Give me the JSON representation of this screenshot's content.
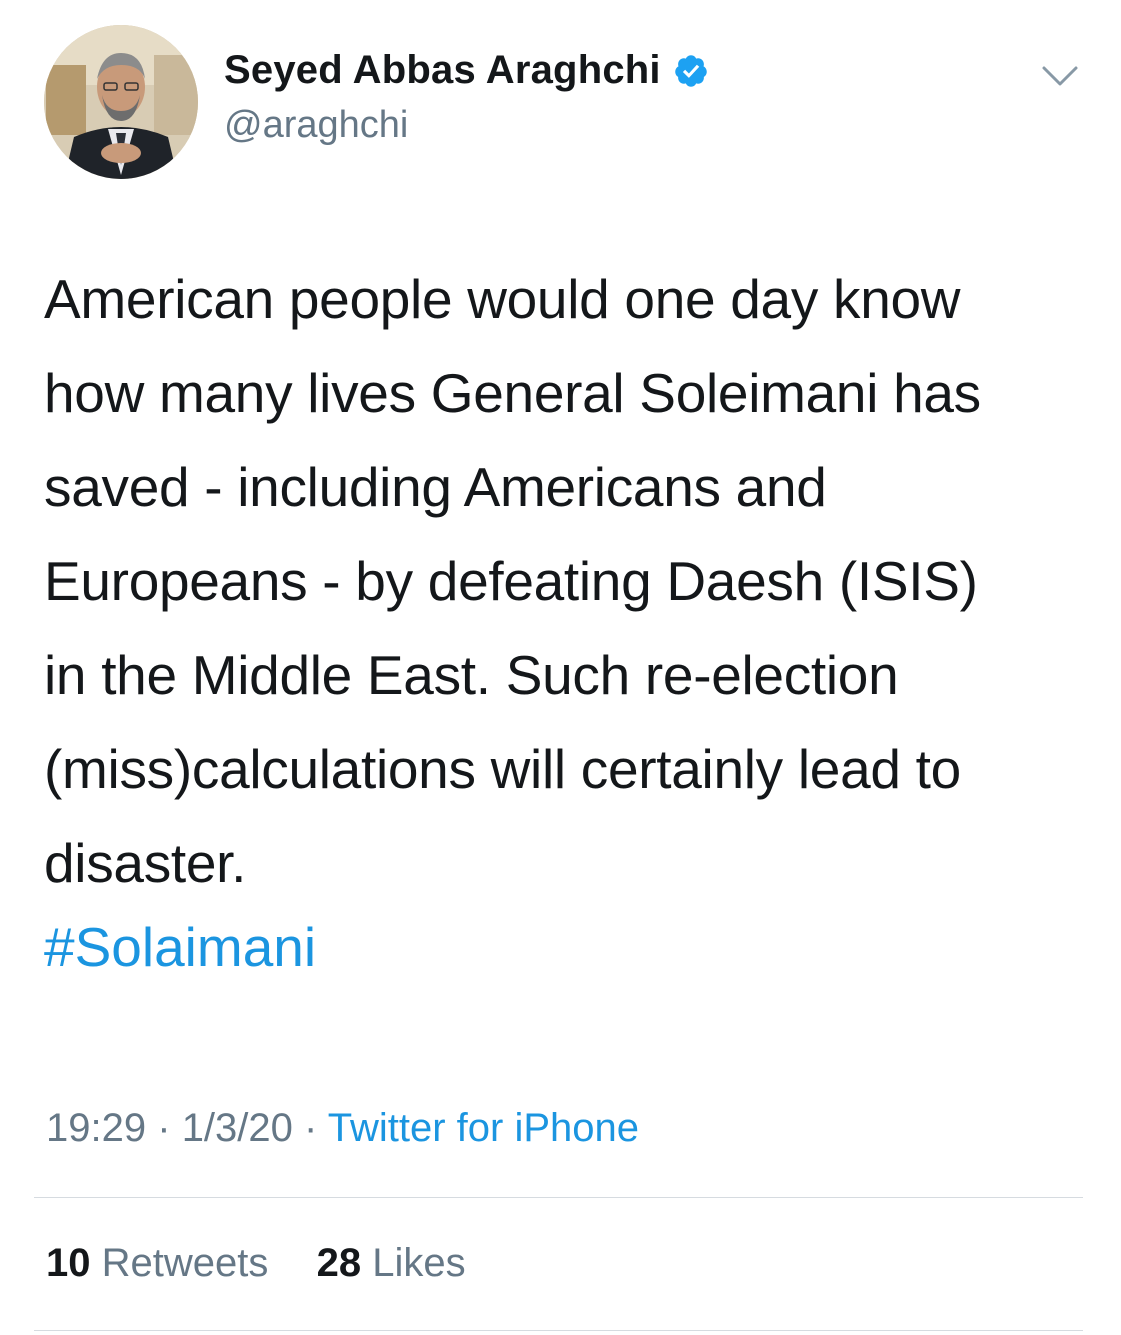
{
  "author": {
    "display_name": "Seyed Abbas Araghchi",
    "handle": "@araghchi",
    "verified_icon": "verified-badge-icon",
    "avatar": "profile-photo",
    "colors": {
      "verified": "#1da1f2"
    }
  },
  "tweet": {
    "text_lines": [
      "American people would one day know",
      "how many lives General Soleimani has",
      "saved - including Americans and",
      "Europeans - by defeating Daesh (ISIS)",
      "in the Middle East. Such re-election",
      "(miss)calculations will certainly lead to",
      "disaster."
    ],
    "hashtag": "#Solaimani",
    "time": "19:29",
    "date": "1/3/20",
    "separator": "·",
    "source": "Twitter for iPhone"
  },
  "stats": {
    "retweets_count": "10",
    "retweets_label": "Retweets",
    "likes_count": "28",
    "likes_label": "Likes"
  },
  "menu_icon": "chevron-down-icon",
  "colors": {
    "text": "#14171a",
    "secondary": "#657786",
    "link": "#1b95e0",
    "divider": "#d6dbe0"
  }
}
